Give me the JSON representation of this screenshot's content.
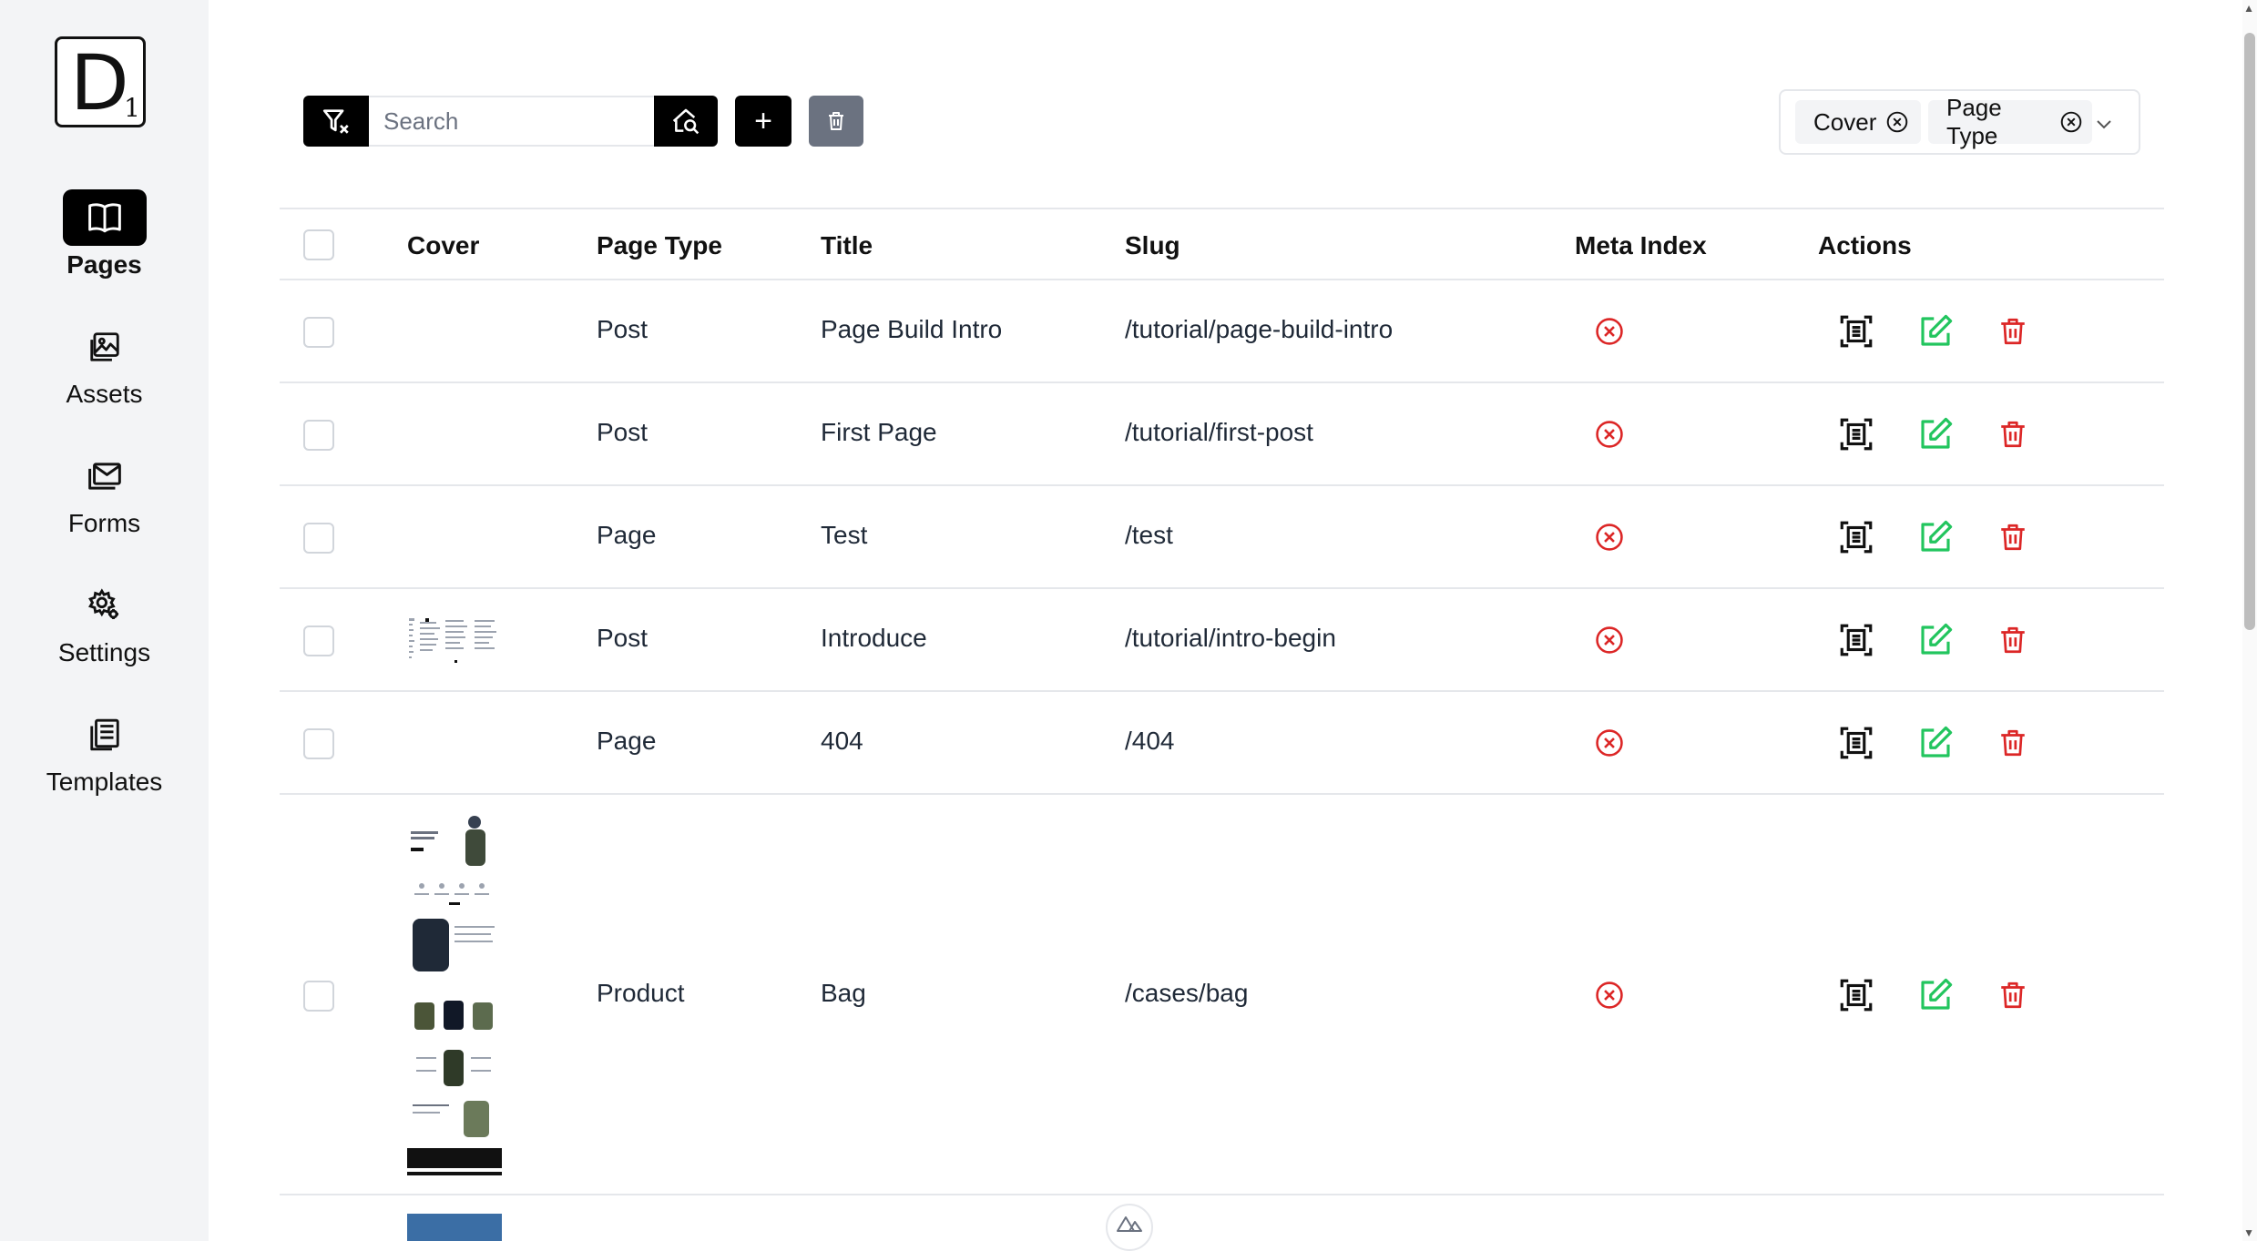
{
  "sidebar": {
    "logo_letter": "D",
    "logo_sub": "1",
    "items": [
      {
        "label": "Pages",
        "icon": "book-open-icon",
        "active": true
      },
      {
        "label": "Assets",
        "icon": "images-icon",
        "active": false
      },
      {
        "label": "Forms",
        "icon": "envelope-icon",
        "active": false
      },
      {
        "label": "Settings",
        "icon": "cog-icon",
        "active": false
      },
      {
        "label": "Templates",
        "icon": "newspaper-icon",
        "active": false
      }
    ]
  },
  "toolbar": {
    "search_placeholder": "Search",
    "add_label": "+",
    "visible_columns": [
      "Cover",
      "Page Type"
    ]
  },
  "table": {
    "headers": {
      "cover": "Cover",
      "page_type": "Page Type",
      "title": "Title",
      "slug": "Slug",
      "meta_index": "Meta Index",
      "actions": "Actions"
    },
    "rows": [
      {
        "cover": "",
        "page_type": "Post",
        "title": "Page Build Intro",
        "slug": "/tutorial/page-build-intro",
        "meta_index": false
      },
      {
        "cover": "",
        "page_type": "Post",
        "title": "First Page",
        "slug": "/tutorial/first-post",
        "meta_index": false
      },
      {
        "cover": "",
        "page_type": "Page",
        "title": "Test",
        "slug": "/test",
        "meta_index": false
      },
      {
        "cover": "screenshot-thumbnail",
        "page_type": "Post",
        "title": "Introduce",
        "slug": "/tutorial/intro-begin",
        "meta_index": false
      },
      {
        "cover": "",
        "page_type": "Page",
        "title": "404",
        "slug": "/404",
        "meta_index": false
      },
      {
        "cover": "product-page-thumbnail",
        "page_type": "Product",
        "title": "Bag",
        "slug": "/cases/bag",
        "meta_index": false
      }
    ]
  },
  "colors": {
    "primary": "#000000",
    "danger": "#dc2626",
    "success": "#22c55e",
    "muted": "#6b7280",
    "sidebar_bg": "#f3f4f6"
  }
}
